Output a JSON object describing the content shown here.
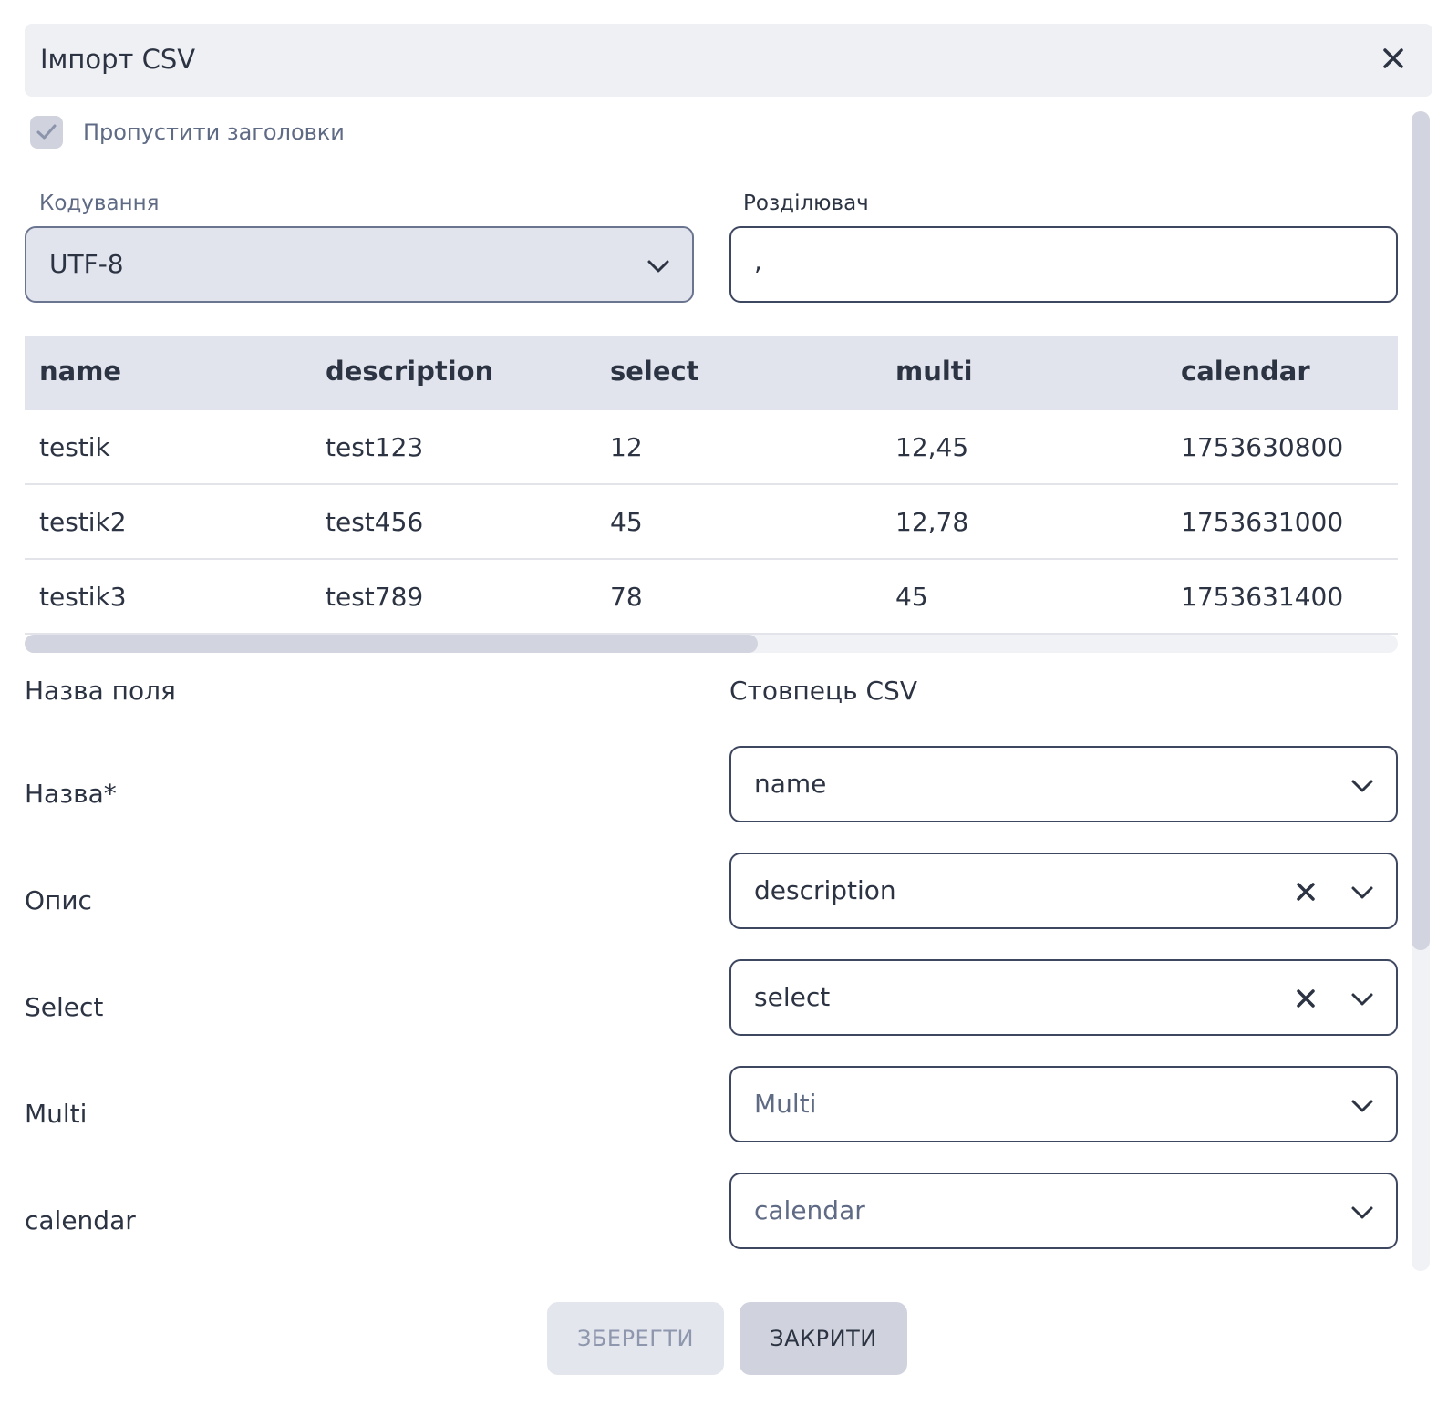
{
  "dialog": {
    "title": "Імпорт CSV",
    "skip_headers_label": "Пропустити заголовки",
    "skip_headers_checked": true
  },
  "encoding": {
    "label": "Кодування",
    "value": "UTF-8"
  },
  "separator": {
    "label": "Розділювач",
    "value": ","
  },
  "preview_table": {
    "columns": [
      "name",
      "description",
      "select",
      "multi",
      "calendar"
    ],
    "rows": [
      [
        "testik",
        "test123",
        "12",
        "12,45",
        "1753630800"
      ],
      [
        "testik2",
        "test456",
        "45",
        "12,78",
        "1753631000"
      ],
      [
        "testik3",
        "test789",
        "78",
        "45",
        "1753631400"
      ]
    ]
  },
  "mapping": {
    "field_header": "Назва поля",
    "column_header": "Стовпець CSV",
    "rows": [
      {
        "field": "Назва*",
        "column": "name",
        "placeholder": false,
        "clearable": false
      },
      {
        "field": "Опис",
        "column": "description",
        "placeholder": false,
        "clearable": true
      },
      {
        "field": "Select",
        "column": "select",
        "placeholder": false,
        "clearable": true
      },
      {
        "field": "Multi",
        "column": "Multi",
        "placeholder": true,
        "clearable": false
      },
      {
        "field": "calendar",
        "column": "calendar",
        "placeholder": true,
        "clearable": false
      }
    ]
  },
  "buttons": {
    "save": "ЗБЕРЕГТИ",
    "close": "ЗАКРИТИ"
  },
  "colors": {
    "header_bg": "#eef0f4",
    "table_header_bg": "#e1e4ec",
    "border": "#3e4760",
    "text": "#2c3342",
    "muted_text": "#5f6b85"
  }
}
